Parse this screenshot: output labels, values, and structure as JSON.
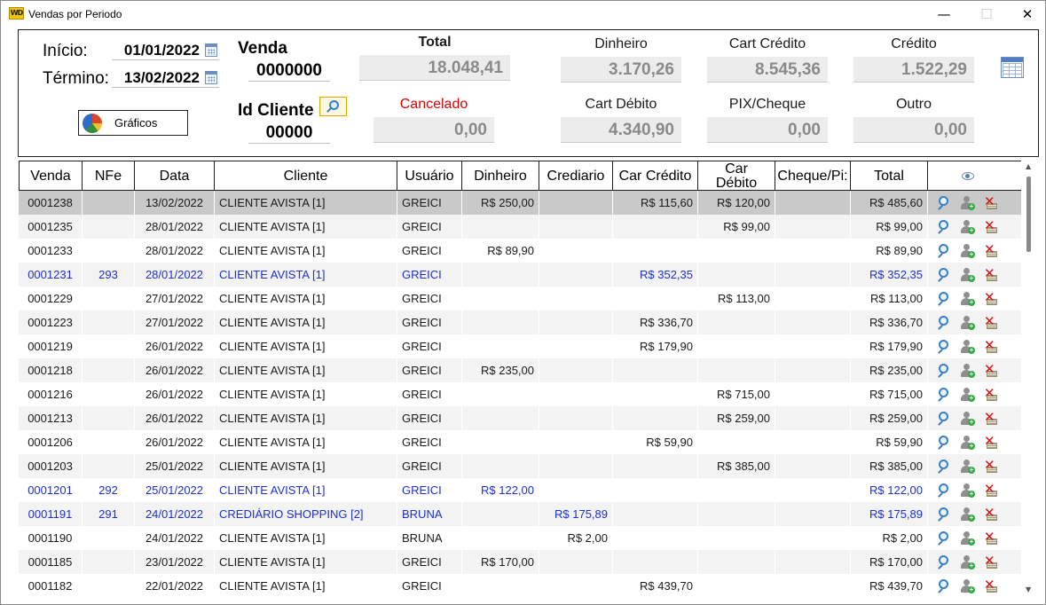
{
  "window": {
    "title": "Vendas por Periodo",
    "app_icon": "WD",
    "min": "—",
    "max": "☐",
    "close": "✕"
  },
  "filters": {
    "inicio_label": "Início:",
    "inicio_value": "01/01/2022",
    "termino_label": "Término:",
    "termino_value": "13/02/2022",
    "venda_label": "Venda",
    "venda_value": "0000000",
    "id_cliente_label": "Id Cliente",
    "id_cliente_value": "00000",
    "graficos_label": "Gráficos"
  },
  "totals": {
    "total_label": "Total",
    "total_value": "18.048,41",
    "dinheiro_label": "Dinheiro",
    "dinheiro_value": "3.170,26",
    "cart_credito_label": "Cart Crédito",
    "cart_credito_value": "8.545,36",
    "credito_label": "Crédito",
    "credito_value": "1.522,29",
    "cancelado_label": "Cancelado",
    "cancelado_value": "0,00",
    "cart_debito_label": "Cart Débito",
    "cart_debito_value": "4.340,90",
    "pix_label": "PIX/Cheque",
    "pix_value": "0,00",
    "outro_label": "Outro",
    "outro_value": "0,00"
  },
  "colors": {
    "cancelado": "#e00000",
    "link_row": "#1c2fd6",
    "selected_row": "#c9c9c9",
    "alt_row": "#f3f3f3"
  },
  "table": {
    "headers": {
      "venda": "Venda",
      "nfe": "NFe",
      "data": "Data",
      "cliente": "Cliente",
      "usuario": "Usuário",
      "dinheiro": "Dinheiro",
      "crediario": "Crediario",
      "car_credito": "Car Crédito",
      "car_debito_1": "Car",
      "car_debito_2": "Débito",
      "cheque_pix": "Cheque/Pi:",
      "total": "Total",
      "actions_icon": "eye-icon"
    },
    "rows": [
      {
        "venda": "0001238",
        "nfe": "",
        "data": "13/02/2022",
        "cliente": "CLIENTE AVISTA [1]",
        "usuario": "GREICI",
        "dinheiro": "R$ 250,00",
        "crediario": "",
        "car_credito": "R$ 115,60",
        "car_debito": "R$ 120,00",
        "cheque_pix": "",
        "total": "R$ 485,60",
        "style": "sel"
      },
      {
        "venda": "0001235",
        "nfe": "",
        "data": "28/01/2022",
        "cliente": "CLIENTE AVISTA [1]",
        "usuario": "GREICI",
        "dinheiro": "",
        "crediario": "",
        "car_credito": "",
        "car_debito": "R$ 99,00",
        "cheque_pix": "",
        "total": "R$ 99,00",
        "style": "alt"
      },
      {
        "venda": "0001233",
        "nfe": "",
        "data": "28/01/2022",
        "cliente": "CLIENTE AVISTA [1]",
        "usuario": "GREICI",
        "dinheiro": "R$ 89,90",
        "crediario": "",
        "car_credito": "",
        "car_debito": "",
        "cheque_pix": "",
        "total": "R$ 89,90",
        "style": ""
      },
      {
        "venda": "0001231",
        "nfe": "293",
        "data": "28/01/2022",
        "cliente": "CLIENTE AVISTA [1]",
        "usuario": "GREICI",
        "dinheiro": "",
        "crediario": "",
        "car_credito": "R$ 352,35",
        "car_debito": "",
        "cheque_pix": "",
        "total": "R$ 352,35",
        "style": "alt blue"
      },
      {
        "venda": "0001229",
        "nfe": "",
        "data": "27/01/2022",
        "cliente": "CLIENTE AVISTA [1]",
        "usuario": "GREICI",
        "dinheiro": "",
        "crediario": "",
        "car_credito": "",
        "car_debito": "R$ 113,00",
        "cheque_pix": "",
        "total": "R$ 113,00",
        "style": ""
      },
      {
        "venda": "0001223",
        "nfe": "",
        "data": "27/01/2022",
        "cliente": "CLIENTE AVISTA [1]",
        "usuario": "GREICI",
        "dinheiro": "",
        "crediario": "",
        "car_credito": "R$ 336,70",
        "car_debito": "",
        "cheque_pix": "",
        "total": "R$ 336,70",
        "style": "alt"
      },
      {
        "venda": "0001219",
        "nfe": "",
        "data": "26/01/2022",
        "cliente": "CLIENTE AVISTA [1]",
        "usuario": "GREICI",
        "dinheiro": "",
        "crediario": "",
        "car_credito": "R$ 179,90",
        "car_debito": "",
        "cheque_pix": "",
        "total": "R$ 179,90",
        "style": ""
      },
      {
        "venda": "0001218",
        "nfe": "",
        "data": "26/01/2022",
        "cliente": "CLIENTE AVISTA [1]",
        "usuario": "GREICI",
        "dinheiro": "R$ 235,00",
        "crediario": "",
        "car_credito": "",
        "car_debito": "",
        "cheque_pix": "",
        "total": "R$ 235,00",
        "style": "alt"
      },
      {
        "venda": "0001216",
        "nfe": "",
        "data": "26/01/2022",
        "cliente": "CLIENTE AVISTA [1]",
        "usuario": "GREICI",
        "dinheiro": "",
        "crediario": "",
        "car_credito": "",
        "car_debito": "R$ 715,00",
        "cheque_pix": "",
        "total": "R$ 715,00",
        "style": ""
      },
      {
        "venda": "0001213",
        "nfe": "",
        "data": "26/01/2022",
        "cliente": "CLIENTE AVISTA [1]",
        "usuario": "GREICI",
        "dinheiro": "",
        "crediario": "",
        "car_credito": "",
        "car_debito": "R$ 259,00",
        "cheque_pix": "",
        "total": "R$ 259,00",
        "style": "alt"
      },
      {
        "venda": "0001206",
        "nfe": "",
        "data": "26/01/2022",
        "cliente": "CLIENTE AVISTA [1]",
        "usuario": "GREICI",
        "dinheiro": "",
        "crediario": "",
        "car_credito": "R$ 59,90",
        "car_debito": "",
        "cheque_pix": "",
        "total": "R$ 59,90",
        "style": ""
      },
      {
        "venda": "0001203",
        "nfe": "",
        "data": "25/01/2022",
        "cliente": "CLIENTE AVISTA [1]",
        "usuario": "GREICI",
        "dinheiro": "",
        "crediario": "",
        "car_credito": "",
        "car_debito": "R$ 385,00",
        "cheque_pix": "",
        "total": "R$ 385,00",
        "style": "alt"
      },
      {
        "venda": "0001201",
        "nfe": "292",
        "data": "25/01/2022",
        "cliente": "CLIENTE AVISTA [1]",
        "usuario": "GREICI",
        "dinheiro": "R$ 122,00",
        "crediario": "",
        "car_credito": "",
        "car_debito": "",
        "cheque_pix": "",
        "total": "R$ 122,00",
        "style": "blue"
      },
      {
        "venda": "0001191",
        "nfe": "291",
        "data": "24/01/2022",
        "cliente": "CREDIÁRIO SHOPPING [2]",
        "usuario": "BRUNA",
        "dinheiro": "",
        "crediario": "R$ 175,89",
        "car_credito": "",
        "car_debito": "",
        "cheque_pix": "",
        "total": "R$ 175,89",
        "style": "alt blue"
      },
      {
        "venda": "0001190",
        "nfe": "",
        "data": "24/01/2022",
        "cliente": "CLIENTE AVISTA [1]",
        "usuario": "BRUNA",
        "dinheiro": "",
        "crediario": "R$ 2,00",
        "car_credito": "",
        "car_debito": "",
        "cheque_pix": "",
        "total": "R$ 2,00",
        "style": ""
      },
      {
        "venda": "0001185",
        "nfe": "",
        "data": "23/01/2022",
        "cliente": "CLIENTE AVISTA [1]",
        "usuario": "GREICI",
        "dinheiro": "R$ 170,00",
        "crediario": "",
        "car_credito": "",
        "car_debito": "",
        "cheque_pix": "",
        "total": "R$ 170,00",
        "style": "alt"
      },
      {
        "venda": "0001182",
        "nfe": "",
        "data": "22/01/2022",
        "cliente": "CLIENTE AVISTA [1]",
        "usuario": "GREICI",
        "dinheiro": "",
        "crediario": "",
        "car_credito": "R$ 439,70",
        "car_debito": "",
        "cheque_pix": "",
        "total": "R$ 439,70",
        "style": ""
      }
    ]
  }
}
